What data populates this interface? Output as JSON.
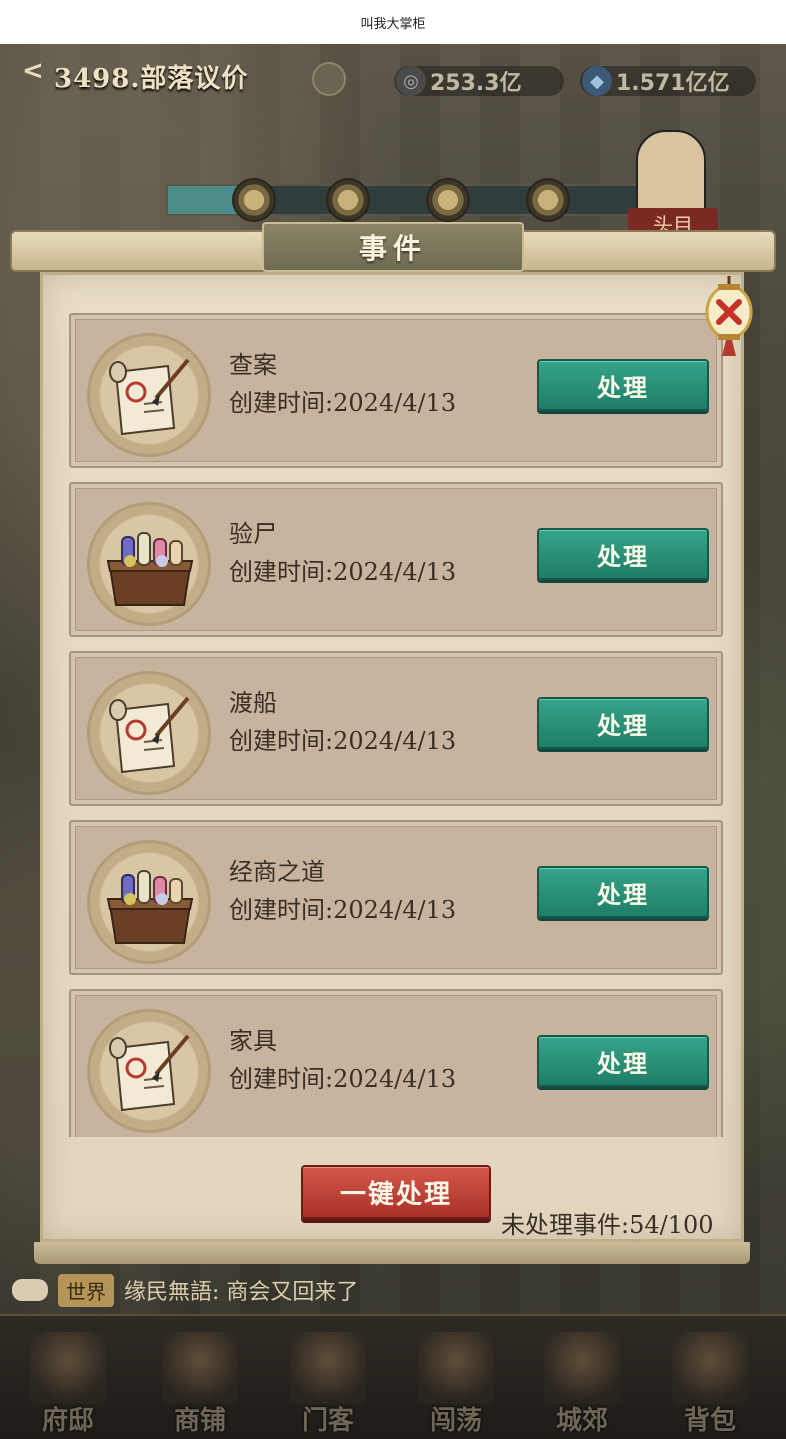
{
  "window": {
    "title": "叫我大掌柜"
  },
  "hud": {
    "back_arrow": "<",
    "title": "3498.部落议价",
    "resources": [
      {
        "icon": "silver-coin-icon",
        "value": "253.3亿"
      },
      {
        "icon": "diamond-icon",
        "value": "1.571亿亿"
      }
    ],
    "headman_label": "头目"
  },
  "dialog": {
    "title": "事件",
    "events": [
      {
        "name": "查案",
        "time": "创建时间:2024/4/13",
        "icon": "scroll-quill-icon",
        "button": "处理"
      },
      {
        "name": "验尸",
        "time": "创建时间:2024/4/13",
        "icon": "treasure-chest-icon",
        "button": "处理"
      },
      {
        "name": "渡船",
        "time": "创建时间:2024/4/13",
        "icon": "scroll-quill-icon",
        "button": "处理"
      },
      {
        "name": "经商之道",
        "time": "创建时间:2024/4/13",
        "icon": "treasure-chest-icon",
        "button": "处理"
      },
      {
        "name": "家具",
        "time": "创建时间:2024/4/13",
        "icon": "scroll-quill-icon",
        "button": "处理"
      }
    ],
    "one_key_button": "一键处理",
    "unprocessed": "未处理事件:54/100",
    "close_icon": "lantern-close-icon"
  },
  "chat": {
    "channel": "世界",
    "text": "缘民無語: 商会又回来了"
  },
  "nav": {
    "items": [
      {
        "label": "府邸",
        "icon": "mansion-icon"
      },
      {
        "label": "商铺",
        "icon": "shop-icon"
      },
      {
        "label": "门客",
        "icon": "retainer-icon"
      },
      {
        "label": "闯荡",
        "icon": "adventure-icon"
      },
      {
        "label": "城郊",
        "icon": "suburb-icon"
      },
      {
        "label": "背包",
        "icon": "backpack-icon"
      }
    ]
  },
  "colors": {
    "accent_green": "#2a917a",
    "accent_red": "#b93a30",
    "parchment": "#e6d9c2"
  }
}
